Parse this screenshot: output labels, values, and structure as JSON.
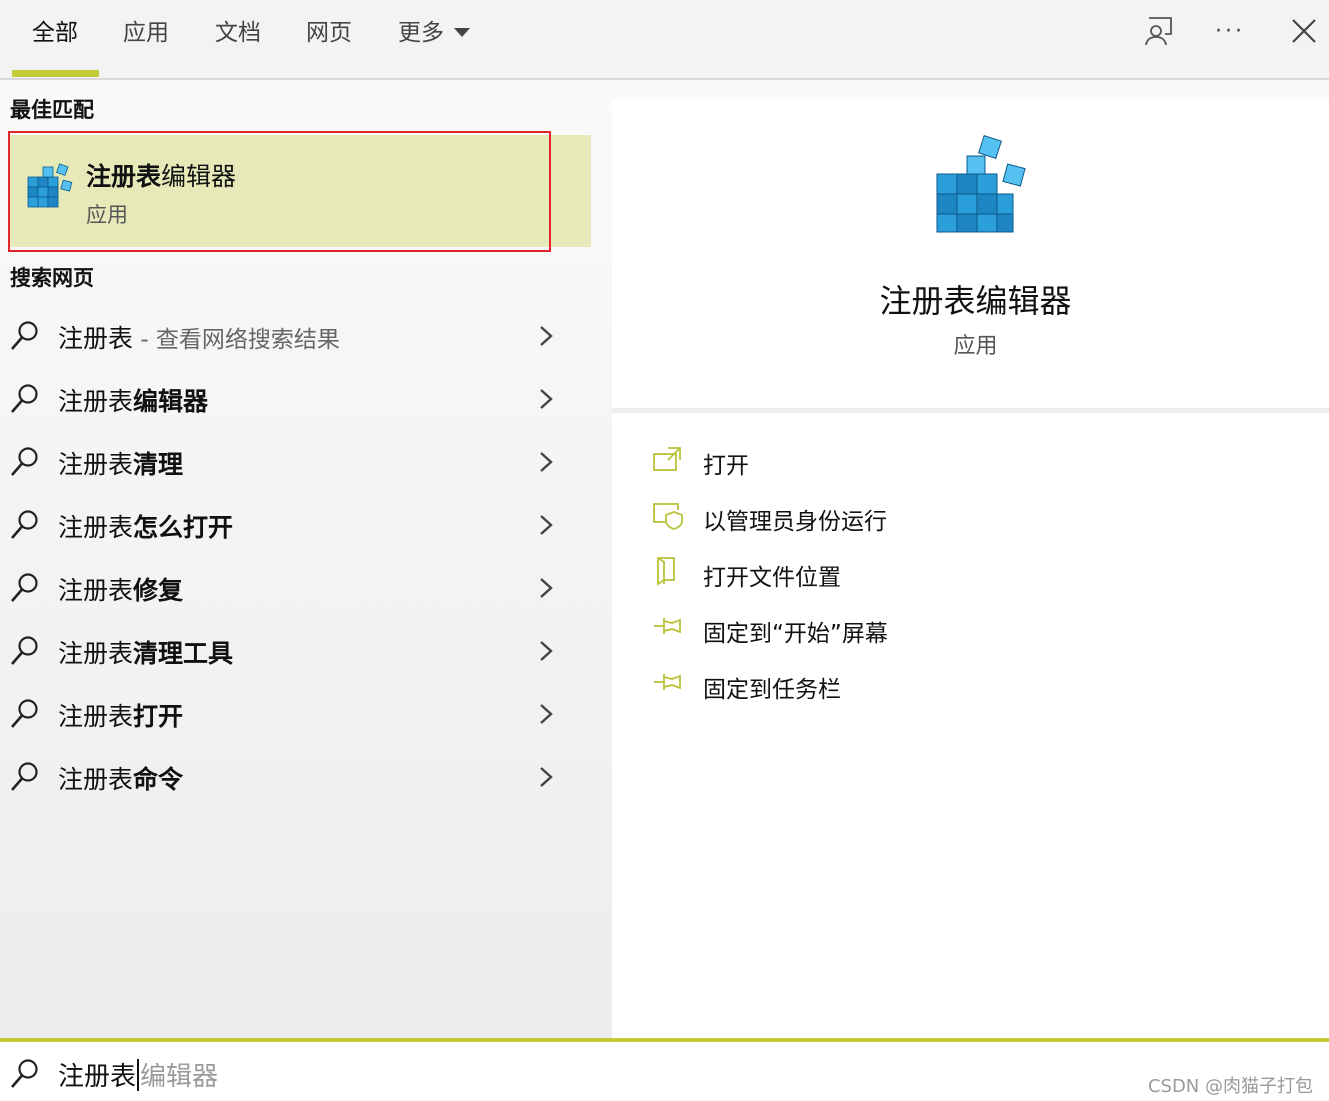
{
  "tabs": [
    {
      "label": "全部",
      "active": true
    },
    {
      "label": "应用"
    },
    {
      "label": "文档"
    },
    {
      "label": "网页"
    },
    {
      "label": "更多"
    }
  ],
  "toolbar_icons": [
    "feedback-icon",
    "more-options-icon",
    "close-icon"
  ],
  "toolbar": {
    "more_dots": "···"
  },
  "left": {
    "best_match_heading": "最佳匹配",
    "best_match": {
      "title_bold": "注册表",
      "title_rest": "编辑器",
      "subtitle": "应用",
      "icon": "registry-editor-icon"
    },
    "web_heading": "搜索网页",
    "results": [
      {
        "prefix": "注册表",
        "bold": "",
        "suffix": " - 查看网络搜索结果"
      },
      {
        "prefix": "注册表",
        "bold": "编辑器",
        "suffix": ""
      },
      {
        "prefix": "注册表",
        "bold": "清理",
        "suffix": ""
      },
      {
        "prefix": "注册表",
        "bold": "怎么打开",
        "suffix": ""
      },
      {
        "prefix": "注册表",
        "bold": "修复",
        "suffix": ""
      },
      {
        "prefix": "注册表",
        "bold": "清理工具",
        "suffix": ""
      },
      {
        "prefix": "注册表",
        "bold": "打开",
        "suffix": ""
      },
      {
        "prefix": "注册表",
        "bold": "命令",
        "suffix": ""
      }
    ]
  },
  "right": {
    "title": "注册表编辑器",
    "subtitle": "应用",
    "actions": [
      {
        "label": "打开",
        "icon": "open-icon"
      },
      {
        "label": "以管理员身份运行",
        "icon": "run-as-admin-icon"
      },
      {
        "label": "打开文件位置",
        "icon": "file-location-icon"
      },
      {
        "label": "固定到“开始”屏幕",
        "icon": "pin-start-icon"
      },
      {
        "label": "固定到任务栏",
        "icon": "pin-taskbar-icon"
      }
    ]
  },
  "search": {
    "typed": "注册表",
    "hint": "编辑器"
  },
  "watermark": "CSDN @肉猫子打包",
  "colors": {
    "accent": "#c3cc37",
    "selected_bg": "#e6eab9",
    "highlight_border": "#e0262b"
  }
}
